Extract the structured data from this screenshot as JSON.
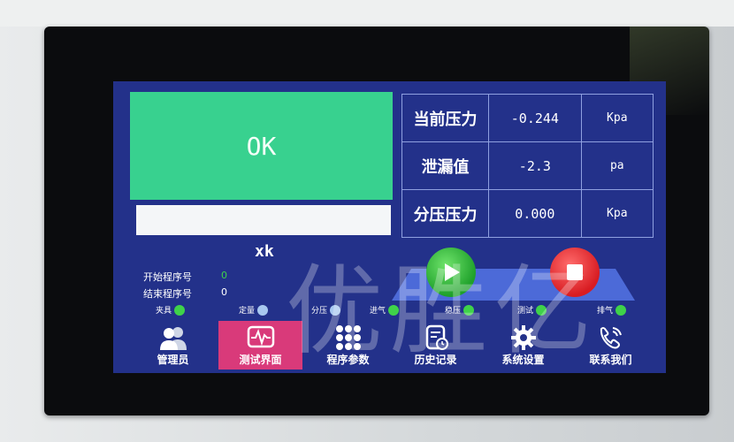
{
  "result": {
    "status": "OK",
    "sub_label": "xk"
  },
  "readings": [
    {
      "label": "当前压力",
      "value": "-0.244",
      "unit": "Kpa"
    },
    {
      "label": "泄漏值",
      "value": "-2.3",
      "unit": "pa"
    },
    {
      "label": "分压压力",
      "value": "0.000",
      "unit": "Kpa"
    }
  ],
  "program": {
    "start_label": "开始程序号",
    "start_value": "0",
    "end_label": "结束程序号",
    "end_value": "0"
  },
  "status_indicators": [
    {
      "label": "夹具",
      "color": "#3fd24a"
    },
    {
      "label": "定量",
      "color": "#a8c8f0"
    },
    {
      "label": "分压",
      "color": "#a8c8f0"
    },
    {
      "label": "进气",
      "color": "#3fd24a"
    },
    {
      "label": "稳压",
      "color": "#3fd24a"
    },
    {
      "label": "测试",
      "color": "#3fd24a"
    },
    {
      "label": "排气",
      "color": "#3fd24a"
    }
  ],
  "nav": [
    {
      "label": "管理员",
      "icon": "users-icon"
    },
    {
      "label": "测试界面",
      "icon": "waveform-monitor-icon",
      "active": true
    },
    {
      "label": "程序参数",
      "icon": "grid-icon"
    },
    {
      "label": "历史记录",
      "icon": "history-document-icon"
    },
    {
      "label": "系统设置",
      "icon": "gear-icon"
    },
    {
      "label": "联系我们",
      "icon": "phone-icon"
    }
  ],
  "watermark": "优胜亿",
  "colors": {
    "screen_bg": "#23318a",
    "ok_panel": "#38d18f",
    "active_nav": "#d93a7a",
    "play": "#1ea02a",
    "stop": "#d81c22"
  }
}
